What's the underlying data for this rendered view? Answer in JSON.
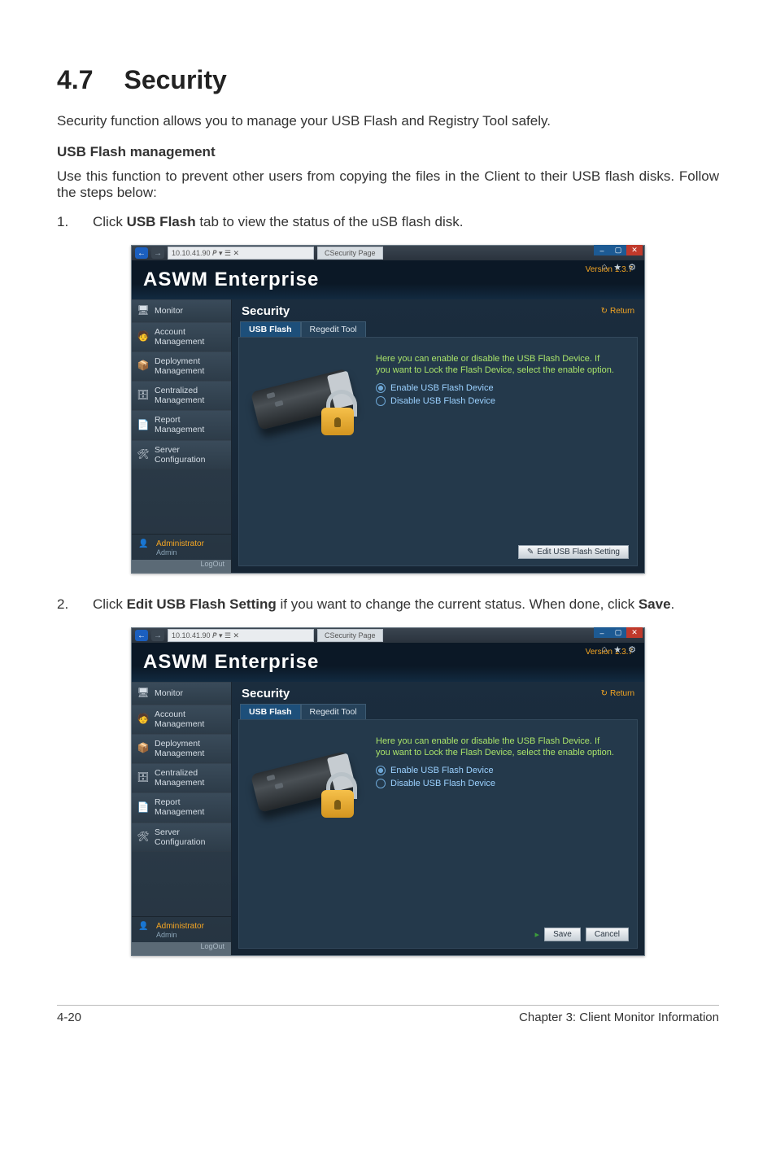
{
  "doc": {
    "section_num": "4.7",
    "section_title": "Security",
    "lead": "Security function allows you to manage your USB Flash and Registry Tool safely.",
    "subhead": "USB Flash management",
    "para1": "Use this function to prevent other users from copying the files in the Client to their USB flash disks. Follow the steps below:",
    "step1_num": "1.",
    "step1_a": "Click ",
    "step1_b": "USB Flash",
    "step1_c": " tab to view the status of the uSB flash disk.",
    "step2_num": "2.",
    "step2_a": "Click ",
    "step2_b": "Edit USB Flash Setting",
    "step2_c": " if you want to change the current status. When done, click ",
    "step2_d": "Save",
    "step2_e": ".",
    "footer_left": "4-20",
    "footer_right": "Chapter 3: Client Monitor Information"
  },
  "app": {
    "browser": {
      "address": "10.10.41.90        𝘗 ▾  ☰ ✕",
      "tab_label": "CSecurity Page",
      "ie_icons": [
        "⌂",
        "★",
        "⚙"
      ]
    },
    "brand": "ASWM Enterprise",
    "version": "Version 1.3.7",
    "sidebar": {
      "items": [
        {
          "icon": "🖥",
          "label": "Monitor"
        },
        {
          "icon": "🧑",
          "label": "Account Management"
        },
        {
          "icon": "📦",
          "label": "Deployment Management"
        },
        {
          "icon": "🗄",
          "label": "Centralized Management"
        },
        {
          "icon": "📄",
          "label": "Report Management"
        },
        {
          "icon": "🛠",
          "label": "Server Configuration"
        }
      ],
      "user_role": "Administrator",
      "user_name": "Admin",
      "logout": "LogOut"
    },
    "main": {
      "title": "Security",
      "return_label": "Return",
      "tabs": {
        "usb": "USB Flash",
        "regedit": "Regedit Tool"
      },
      "desc_line1": "Here you can enable or disable the USB Flash Device.  If",
      "desc_line2": "you want to Lock the Flash Device, select the enable option.",
      "radio_enable": "Enable USB Flash Device",
      "radio_disable": "Disable USB Flash Device",
      "btn_edit": "Edit USB Flash Setting",
      "btn_save": "Save",
      "btn_cancel": "Cancel"
    }
  }
}
